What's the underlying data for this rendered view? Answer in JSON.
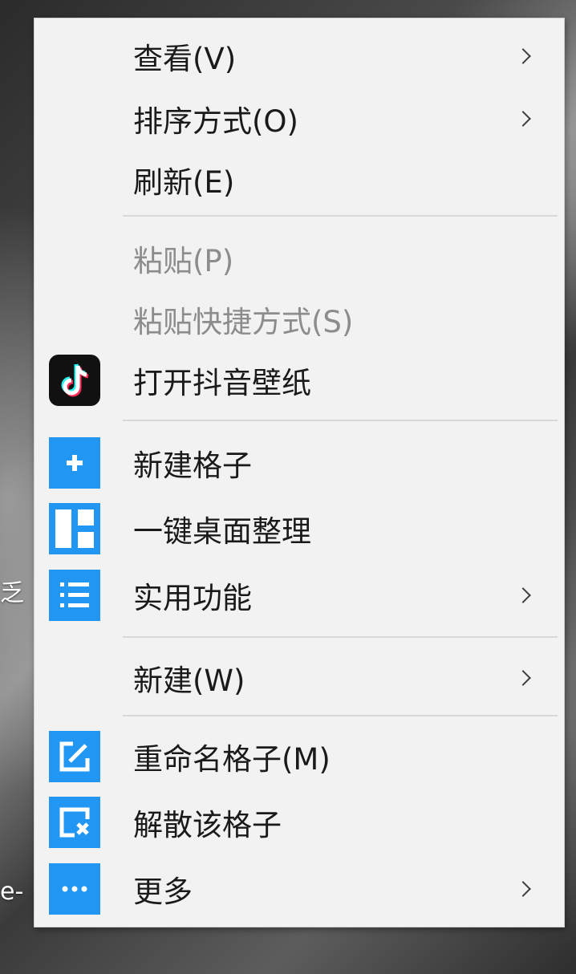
{
  "desktop": {
    "fragment_1": "乏",
    "fragment_2": "e-"
  },
  "menu": {
    "items": [
      {
        "label": "查看(V)",
        "submenu": true,
        "enabled": true
      },
      {
        "label": "排序方式(O)",
        "submenu": true,
        "enabled": true
      },
      {
        "label": "刷新(E)",
        "submenu": false,
        "enabled": true
      },
      {
        "label": "粘贴(P)",
        "submenu": false,
        "enabled": false
      },
      {
        "label": "粘贴快捷方式(S)",
        "submenu": false,
        "enabled": false
      },
      {
        "label": "打开抖音壁纸",
        "submenu": false,
        "enabled": true,
        "icon": "tiktok-icon"
      },
      {
        "label": "新建格子",
        "submenu": false,
        "enabled": true,
        "icon": "plus-icon"
      },
      {
        "label": "一键桌面整理",
        "submenu": false,
        "enabled": true,
        "icon": "layout-icon"
      },
      {
        "label": "实用功能",
        "submenu": true,
        "enabled": true,
        "icon": "list-icon"
      },
      {
        "label": "新建(W)",
        "submenu": true,
        "enabled": true
      },
      {
        "label": "重命名格子(M)",
        "submenu": false,
        "enabled": true,
        "icon": "edit-icon"
      },
      {
        "label": "解散该格子",
        "submenu": false,
        "enabled": true,
        "icon": "dissolve-icon"
      },
      {
        "label": "更多",
        "submenu": true,
        "enabled": true,
        "icon": "more-icon"
      }
    ]
  },
  "colors": {
    "menu_background": "#f2f2f2",
    "accent_blue": "#2196f3",
    "tiktok_black": "#111111",
    "disabled_text": "#8c8c8c"
  }
}
